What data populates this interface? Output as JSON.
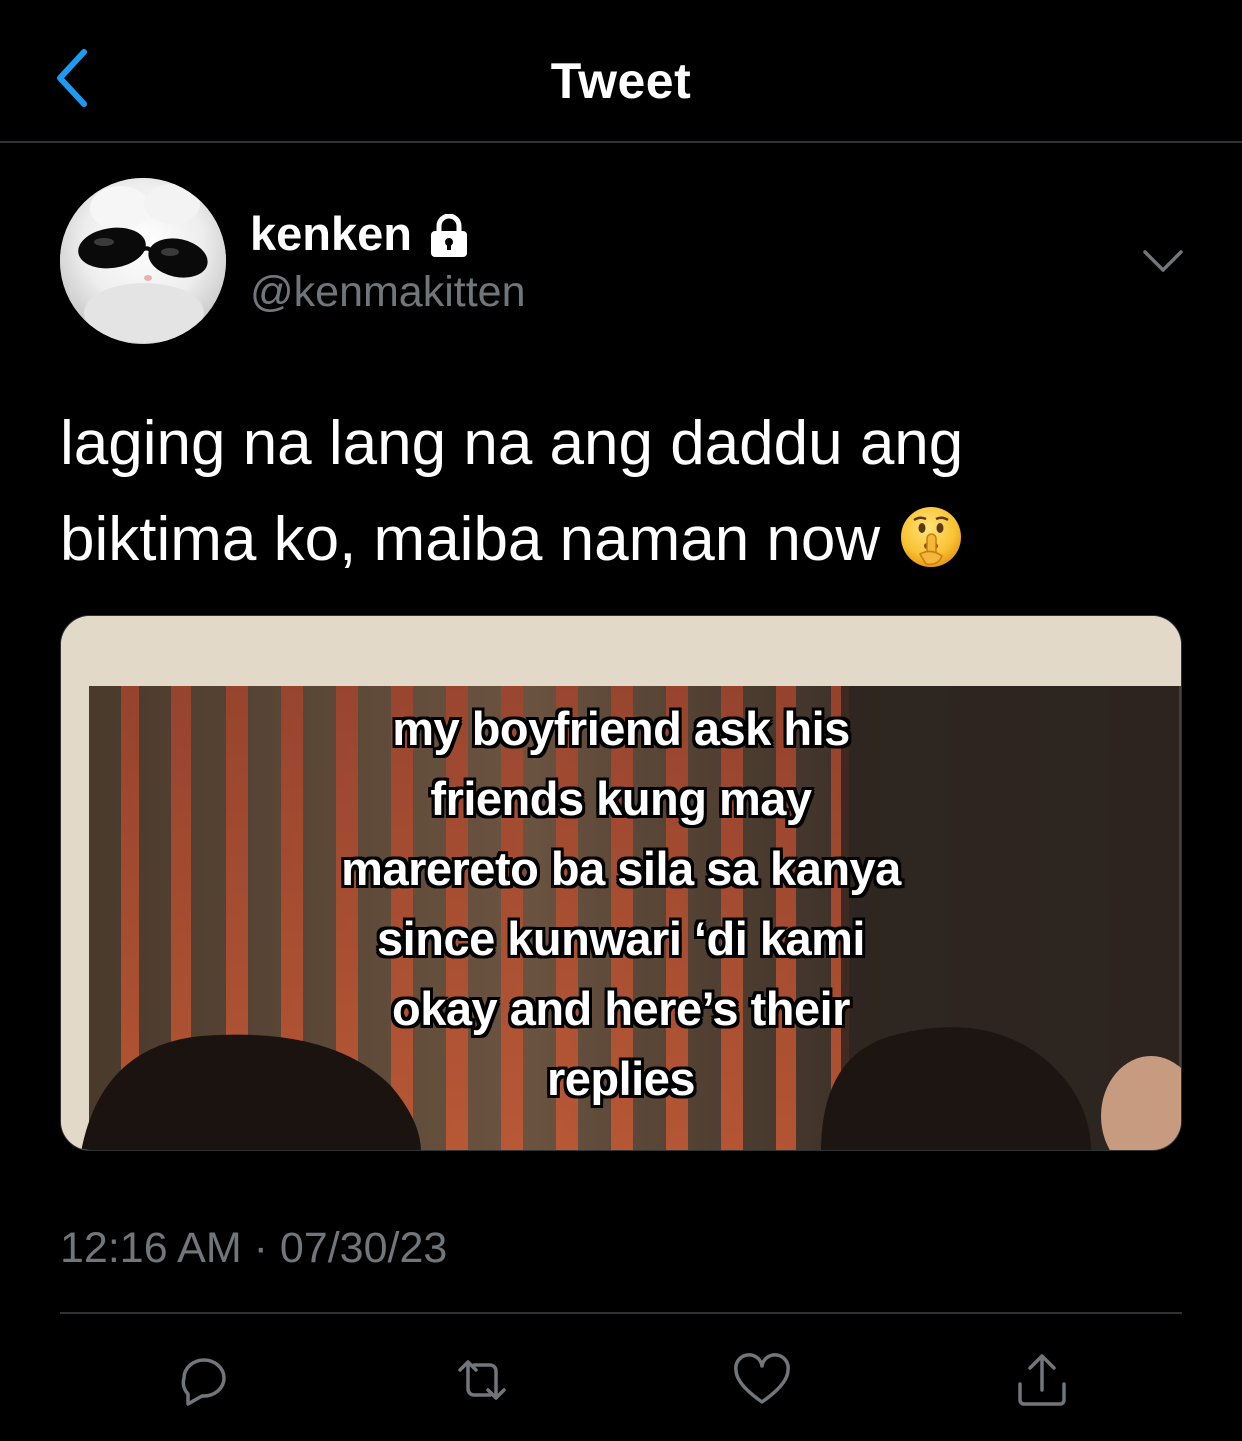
{
  "header": {
    "title": "Tweet",
    "back_icon": "chevron-left-icon",
    "accent_color": "#1d9bf0"
  },
  "tweet": {
    "author": {
      "display_name": "kenken",
      "handle": "@kenmakitten",
      "protected_icon": "lock-icon",
      "avatar": "white cat with black sunglasses"
    },
    "text_lines": [
      "laging na lang na ang daddu ang",
      "biktima ko, maiba naman now"
    ],
    "emoji": "shushing-face-emoji",
    "media": {
      "caption_lines": [
        "my boyfriend ask his",
        "friends kung may",
        "marereto ba sila sa kanya",
        "since kunwari ‘di kami",
        "okay and here’s their",
        "replies"
      ]
    },
    "timestamp": "12:16 AM · 07/30/23"
  },
  "actions": [
    {
      "name": "reply",
      "icon": "reply-icon"
    },
    {
      "name": "retweet",
      "icon": "retweet-icon"
    },
    {
      "name": "like",
      "icon": "heart-icon"
    },
    {
      "name": "share",
      "icon": "share-icon"
    }
  ],
  "colors": {
    "background": "#000000",
    "text": "#ffffff",
    "secondary": "#71767b",
    "divider": "#2f3336"
  }
}
